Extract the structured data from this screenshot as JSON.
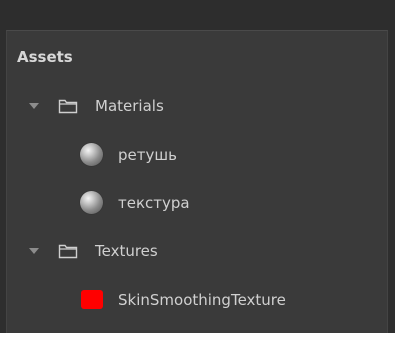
{
  "assets_panel": {
    "title": "Assets",
    "folders": [
      {
        "name": "Materials",
        "items": [
          {
            "name": "ретушь",
            "icon": "material-sphere-icon"
          },
          {
            "name": "текстура",
            "icon": "material-sphere-icon"
          }
        ]
      },
      {
        "name": "Textures",
        "items": [
          {
            "name": "SkinSmoothingTexture",
            "icon": "red-texture-swatch-icon",
            "color": "#ff0000"
          }
        ]
      }
    ]
  },
  "colors": {
    "panel_background": "#3a3a3a",
    "top_bar": "#2d2d2d",
    "text": "#d0d0d0",
    "chevron": "#8c8c8c",
    "texture_swatch": "#ff0000"
  }
}
